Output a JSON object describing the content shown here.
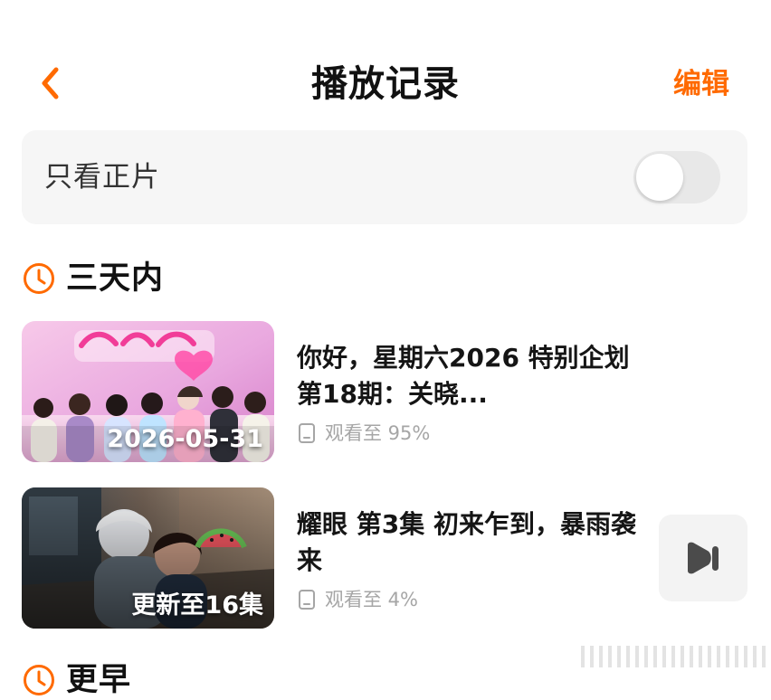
{
  "header": {
    "back_icon": "chevron-left-icon",
    "title": "播放记录",
    "edit_label": "编辑"
  },
  "filter": {
    "label": "只看正片",
    "enabled": false
  },
  "sections": [
    {
      "icon": "clock-icon",
      "title": "三天内",
      "items": [
        {
          "thumbnail_label": "2026-05-31",
          "title": "你好，星期六2026 特别企划第18期：关晓...",
          "progress_label": "观看至 95%",
          "progress_value": 95
        },
        {
          "thumbnail_label": "更新至16集",
          "title": "耀眼 第3集 初来乍到，暴雨袭来",
          "progress_label": "观看至 4%",
          "progress_value": 4,
          "action_icon": "play-next-icon"
        }
      ]
    },
    {
      "icon": "clock-icon",
      "title": "更早"
    }
  ],
  "colors": {
    "accent": "#ff6a00",
    "muted_text": "#a6a6a6",
    "card_background": "#f6f6f6"
  }
}
